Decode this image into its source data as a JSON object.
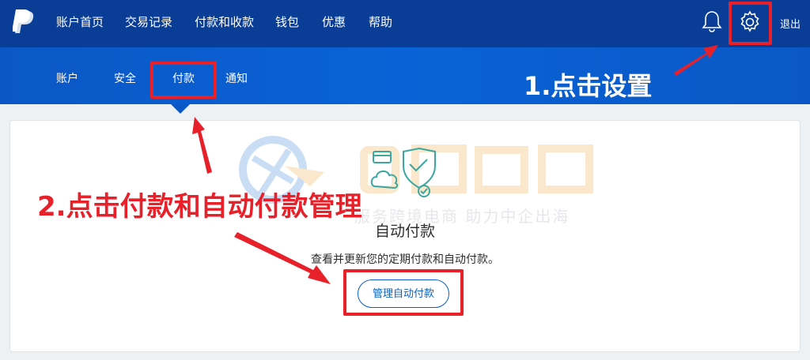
{
  "header": {
    "nav": [
      {
        "label": "账户首页"
      },
      {
        "label": "交易记录"
      },
      {
        "label": "付款和收款"
      },
      {
        "label": "钱包"
      },
      {
        "label": "优惠"
      },
      {
        "label": "帮助"
      }
    ],
    "logout_label": "退出"
  },
  "subnav": {
    "items": [
      {
        "label": "账户"
      },
      {
        "label": "安全"
      },
      {
        "label": "付款"
      },
      {
        "label": "通知"
      }
    ]
  },
  "card": {
    "title": "自动付款",
    "description": "查看并更新您的定期付款和自动付款。",
    "button_label": "管理自动付款"
  },
  "watermark": {
    "text": "服务跨境电商 助力中企出海"
  },
  "annotations": {
    "step1": "1.点击设置",
    "step2": "2.点击付款和自动付款管理"
  },
  "colors": {
    "topbar": "#0a3d95",
    "subbar": "#0b57c6",
    "highlight": "#e8202a",
    "button": "#0a5fc4"
  }
}
